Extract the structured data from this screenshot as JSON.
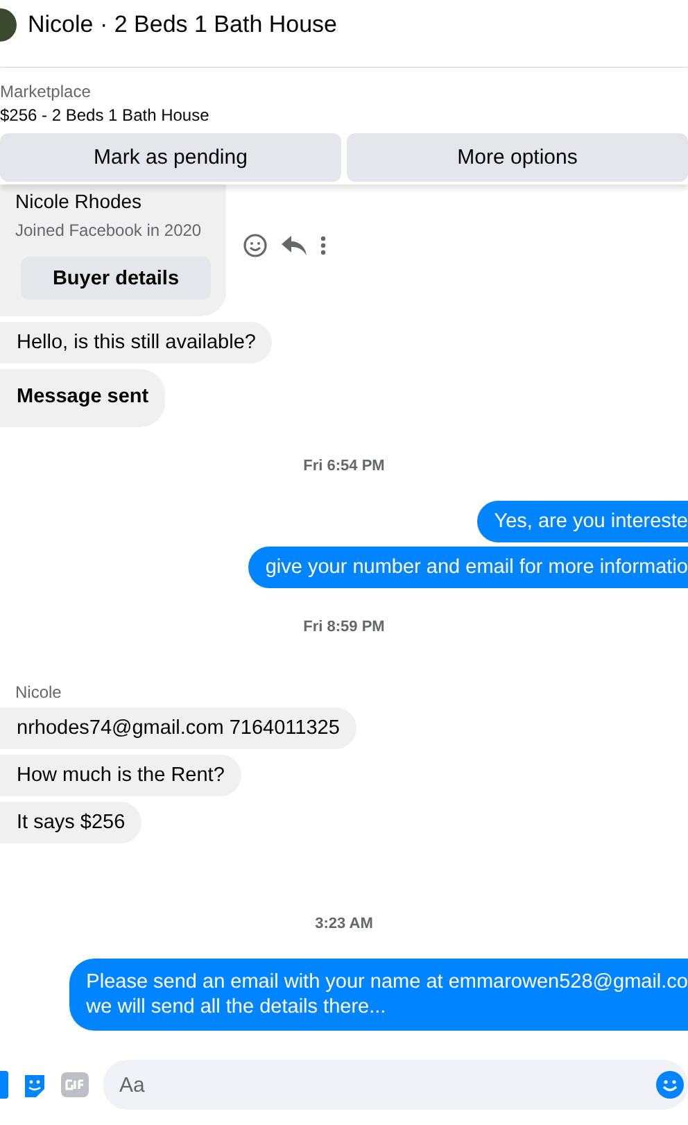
{
  "header": {
    "title": "Nicole · 2 Beds 1 Bath House"
  },
  "listing": {
    "source": "Marketplace",
    "item": "$256 - 2 Beds 1 Bath House",
    "buttons": [
      "Mark as pending",
      "More options"
    ]
  },
  "messages": [
    {
      "kind": "buyer_card",
      "name": "Nicole Rhodes",
      "joined": "Joined Facebook in 2020",
      "button": "Buyer details"
    },
    {
      "kind": "incoming",
      "text": "Hello, is this still available?"
    },
    {
      "kind": "incoming",
      "text": "Message sent",
      "bold": true
    },
    {
      "kind": "timestamp",
      "text": "Fri 6:54 PM"
    },
    {
      "kind": "outgoing",
      "text": "Yes, are you intereste"
    },
    {
      "kind": "outgoing",
      "text": "give your number and email for more informatio"
    },
    {
      "kind": "timestamp",
      "text": "Fri 8:59 PM"
    },
    {
      "kind": "sender",
      "text": "Nicole"
    },
    {
      "kind": "incoming",
      "text": "nrhodes74@gmail.com 7164011325"
    },
    {
      "kind": "incoming",
      "text": "How much is the Rent?"
    },
    {
      "kind": "incoming",
      "text": "It says $256"
    },
    {
      "kind": "timestamp",
      "text": "3:23 AM"
    },
    {
      "kind": "outgoing",
      "text": "Please send an email with your name at emmarowen528@gmail.co\nwe will send all the details there..."
    }
  ],
  "composer": {
    "placeholder": "Aa"
  }
}
